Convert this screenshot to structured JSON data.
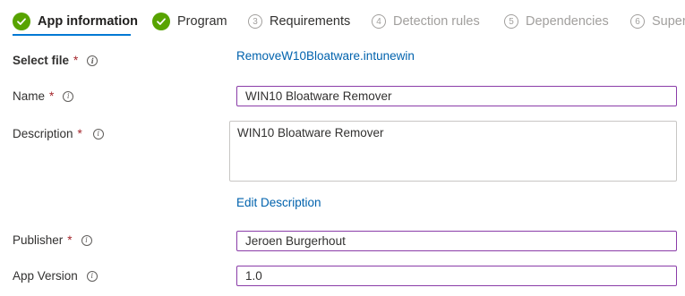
{
  "tabs": [
    {
      "label": "App information",
      "status": "done",
      "active": true
    },
    {
      "label": "Program",
      "status": "done"
    },
    {
      "label": "Requirements",
      "status": "pending",
      "number": "3"
    },
    {
      "label": "Detection rules",
      "status": "pending",
      "number": "4"
    },
    {
      "label": "Dependencies",
      "status": "pending",
      "number": "5"
    },
    {
      "label": "Super",
      "status": "pending",
      "number": "6"
    }
  ],
  "form": {
    "select_file": {
      "label": "Select file",
      "required_mark": "*",
      "value": "RemoveW10Bloatware.intunewin"
    },
    "name": {
      "label": "Name",
      "required_mark": "*",
      "value": "WIN10 Bloatware Remover"
    },
    "description": {
      "label": "Description",
      "required_mark": "*",
      "value": "WIN10 Bloatware Remover",
      "edit_link": "Edit Description"
    },
    "publisher": {
      "label": "Publisher",
      "required_mark": "*",
      "value": "Jeroen Burgerhout"
    },
    "app_version": {
      "label": "App Version",
      "value": "1.0"
    }
  },
  "icons": {
    "done": "checkmark-circle-icon",
    "info": "info-icon"
  },
  "colors": {
    "success": "#57a300",
    "accent": "#0078d4",
    "link": "#0062ad",
    "required": "#a4262c",
    "focus_border": "#8a3ca8"
  }
}
